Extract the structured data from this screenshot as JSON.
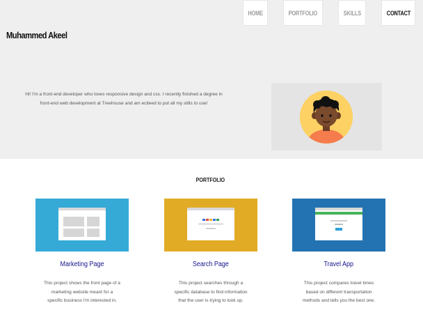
{
  "header": {
    "brand": "Muhammed Akeel",
    "nav": [
      {
        "label": "HOME",
        "active": false
      },
      {
        "label": "PORTFOLIO",
        "active": false
      },
      {
        "label": "SKILLS",
        "active": false
      },
      {
        "label": "CONTACT",
        "active": true
      }
    ]
  },
  "hero": {
    "intro_lines": [
      "Hi! I'm a front-end developer who loves responsive design and css. I recently finished a degree in",
      "front-end web development at Treehouse and am eciteed to put all my stills to use!"
    ],
    "avatar_icon": "user-avatar-icon"
  },
  "portfolio": {
    "title": "PORTFOLIO",
    "projects": [
      {
        "title": "Marketing Page",
        "color": "#35aad6",
        "desc_lines": [
          "This project shows the front page of a",
          "marketing website meant for a",
          "specific business I'm interested in."
        ]
      },
      {
        "title": "Search Page",
        "color": "#e1ab25",
        "desc_lines": [
          "This project searches through a",
          "specific database to find information",
          "that the user is trying to look up."
        ]
      },
      {
        "title": "Travel App",
        "color": "#2373b2",
        "desc_lines": [
          "This project compares travel times",
          "based on different transportation",
          "methods and tells you the best one."
        ]
      }
    ]
  },
  "colors": {
    "hero_bg": "#efefef",
    "avatar_bg": "#fdd163",
    "link": "#14148c"
  }
}
